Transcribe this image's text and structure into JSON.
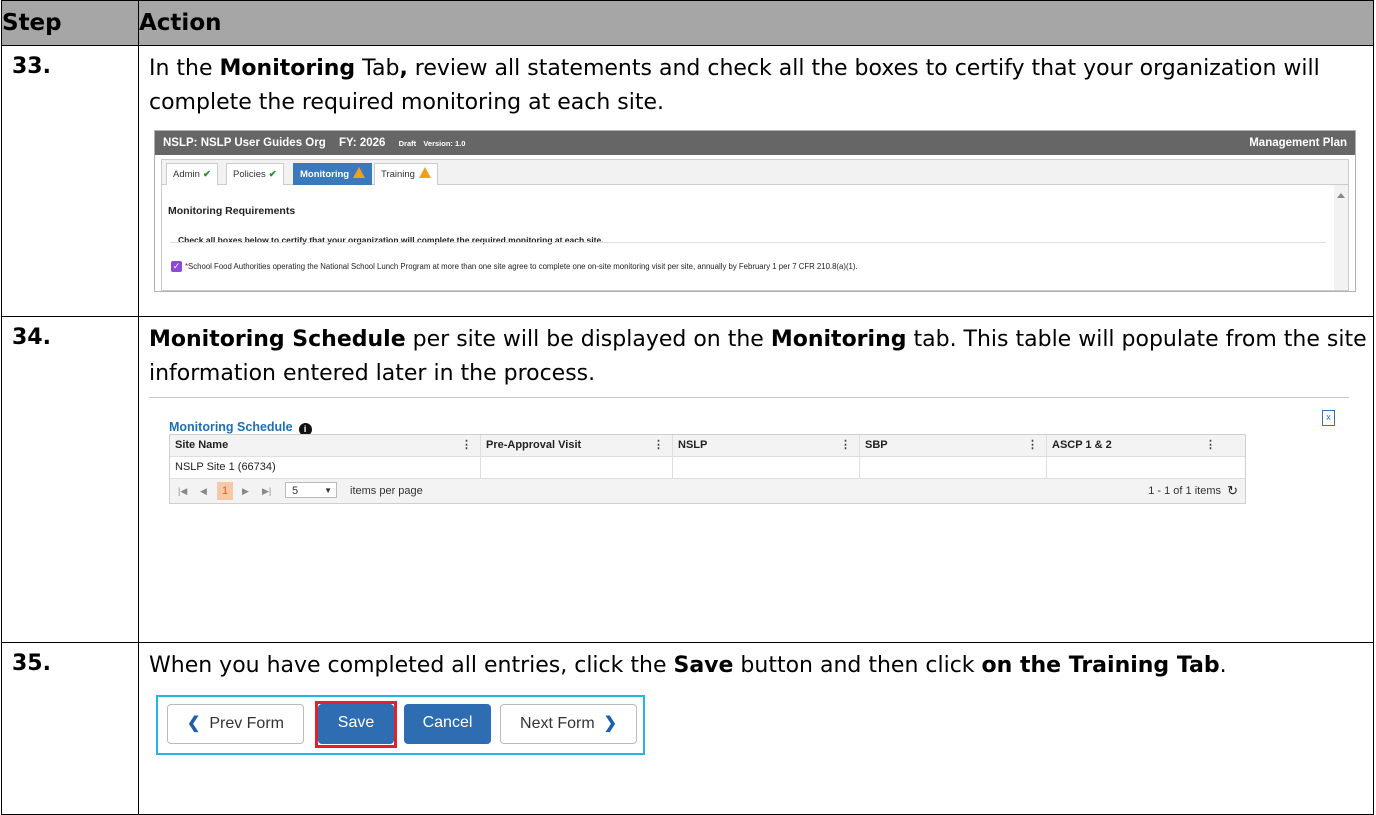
{
  "header": {
    "step": "Step",
    "action": "Action"
  },
  "steps": [
    {
      "num": "33.",
      "text_a": "In the ",
      "bold_a": "Monitoring",
      "text_b": " Tab",
      "bold_b": ",",
      "text_c": " review all statements and check all the boxes to certify that your organization will complete the required monitoring at each site."
    },
    {
      "num": "34.",
      "bold_a": "Monitoring Schedule",
      "text_a": " per site will be displayed on the ",
      "bold_b": "Monitoring",
      "text_b": " tab. This table will populate from the site information entered later in the process."
    },
    {
      "num": "35.",
      "text_a": "When you have completed all entries, click the ",
      "bold_a": "Save",
      "text_b": " button and then click ",
      "bold_b": "on the Training Tab",
      "text_c": "."
    }
  ],
  "shot1": {
    "org": "NSLP: NSLP User Guides Org",
    "fy": "FY: 2026",
    "draft": "Draft",
    "version": "Version: 1.0",
    "plan": "Management Plan",
    "tabs": [
      {
        "label": "Admin",
        "status": "check"
      },
      {
        "label": "Policies",
        "status": "check"
      },
      {
        "label": "Monitoring",
        "status": "warning",
        "active": true
      },
      {
        "label": "Training",
        "status": "warning"
      }
    ],
    "section_title": "Monitoring Requirements",
    "instruction": "Check all boxes below to certify that your organization will complete the required monitoring at each site.",
    "required_mark": "*",
    "checkbox_text": "School Food Authorities operating the National School Lunch Program at more than one site agree to complete one on-site monitoring visit per site, annually by February 1 per 7 CFR 210.8(a)(1).",
    "checkbox_checked": true
  },
  "shot2": {
    "title": "Monitoring Schedule",
    "columns": [
      "Site Name",
      "Pre-Approval Visit",
      "NSLP",
      "SBP",
      "ASCP 1 & 2"
    ],
    "rows": [
      [
        "NSLP Site 1 (66734)",
        "",
        "",
        "",
        ""
      ]
    ],
    "pager": {
      "page": "1",
      "page_size": "5",
      "items_per_page": "items per page",
      "count": "1 - 1 of 1 items"
    }
  },
  "shot3": {
    "prev": "Prev Form",
    "save": "Save",
    "cancel": "Cancel",
    "next": "Next Form"
  }
}
